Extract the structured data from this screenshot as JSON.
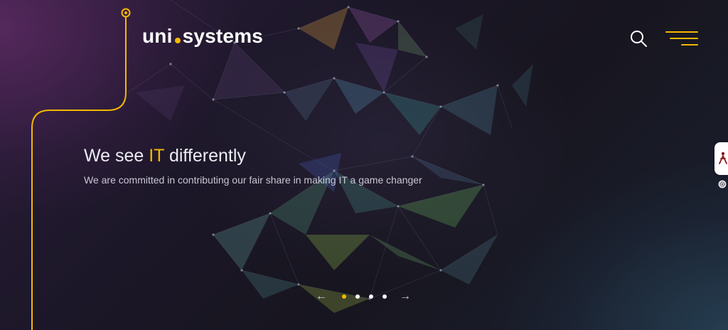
{
  "header": {
    "logo_left": "uni",
    "logo_right": "systems",
    "search_icon": "search-icon",
    "menu_icon": "hamburger-menu-icon"
  },
  "hero": {
    "title_before": "We see ",
    "title_highlight": "IT",
    "title_after": " differently",
    "subtitle": "We are committed in contributing our fair share in making IT a game changer"
  },
  "slider": {
    "prev_label": "←",
    "next_label": "→",
    "slide_count": 4,
    "active_slide": 1
  },
  "side_widget": {
    "icon": "accessibility-person-icon",
    "settings_icon": "gear-icon"
  },
  "colors": {
    "accent": "#f5b800",
    "text": "#ececf2",
    "subtext": "#c9c6d4",
    "background": "#1a1624"
  }
}
